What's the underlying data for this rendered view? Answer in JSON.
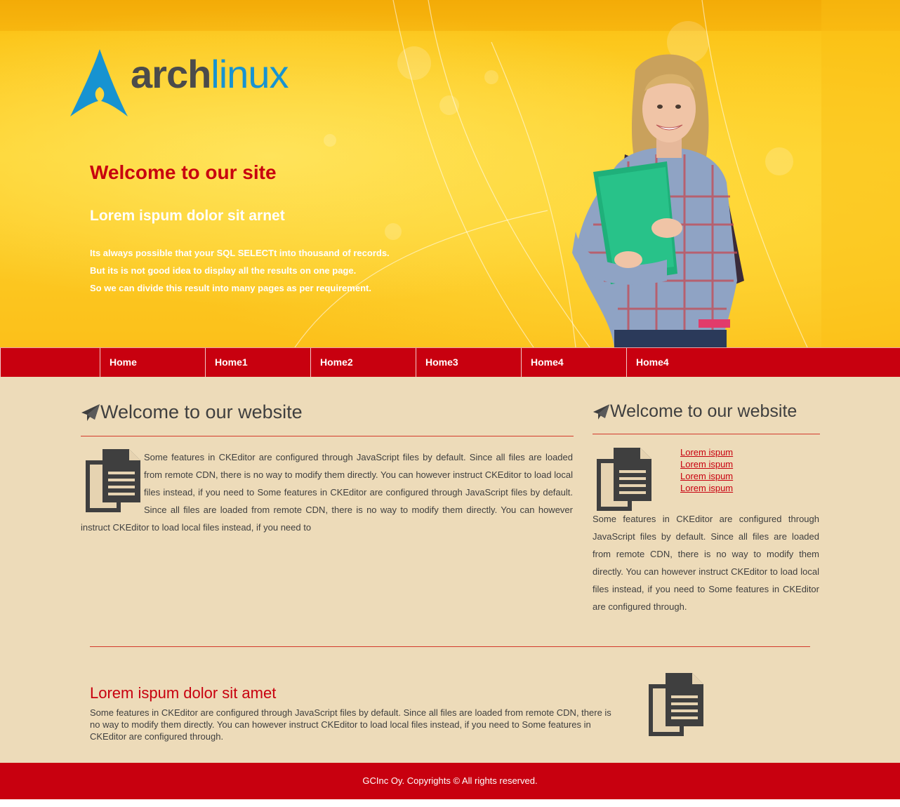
{
  "hero": {
    "logo": {
      "arch": "arch",
      "linux": "linux"
    },
    "title": "Welcome to our site",
    "subtitle": "Lorem ispum dolor sit arnet",
    "lines": [
      "Its always possible that your SQL SELECTt into thousand of records.",
      "But its is not good idea to display all the results on one page.",
      "So we can divide this result into many pages as per requirement."
    ]
  },
  "nav": {
    "items": [
      {
        "label": "Home"
      },
      {
        "label": "Home1"
      },
      {
        "label": "Home2"
      },
      {
        "label": "Home3"
      },
      {
        "label": "Home4"
      },
      {
        "label": "Home4"
      }
    ]
  },
  "main": {
    "left": {
      "heading": "Welcome to our website",
      "text": "Some features in CKEditor are configured through JavaScript files by default. Since all files are loaded from remote CDN, there is no way to modify them directly. You can however instruct CKEditor to load local files instead, if you need to Some features in CKEditor are configured through JavaScript files by default. Since all files are loaded from remote CDN, there is no way to modify them directly. You can however instruct CKEditor to load local files instead, if you need to"
    },
    "right": {
      "heading": "Welcome to our website",
      "links": [
        "Lorem ispum",
        "Lorem ispum",
        "Lorem ispum",
        "Lorem ispum"
      ],
      "text": "Some features in CKEditor are configured through JavaScript files by default. Since all files are loaded from remote CDN, there is no way to modify them directly. You can however instruct CKEditor to load local files instead, if you need to Some features in CKEditor are configured through."
    },
    "bottom": {
      "title": "Lorem ispum dolor sit amet",
      "text": "Some features in CKEditor are configured through JavaScript files by default. Since all files are loaded from remote CDN, there is no way to modify them directly. You can however instruct CKEditor to load local files instead, if you need to Some features in CKEditor are configured through."
    }
  },
  "footer": {
    "text": "GCInc Oy. Copyrights © All rights reserved."
  },
  "colors": {
    "accent": "#c8000f",
    "content_bg": "#eddbb9",
    "hero_yellow": "#fdd22a",
    "arch_blue": "#1793d1"
  },
  "icons": [
    "arch-logo-icon",
    "paper-plane-icon",
    "document-icon"
  ]
}
